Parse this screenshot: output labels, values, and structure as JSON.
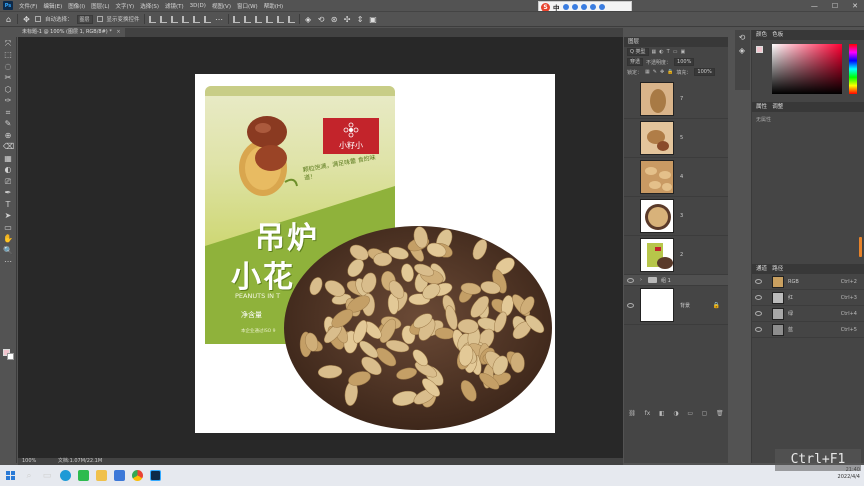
{
  "app": {
    "logo_text": "Ps"
  },
  "menu": [
    "文件(F)",
    "编辑(E)",
    "图像(I)",
    "图层(L)",
    "文字(Y)",
    "选择(S)",
    "滤镜(T)",
    "3D(D)",
    "视图(V)",
    "窗口(W)",
    "帮助(H)"
  ],
  "window_controls": {
    "minimize": "—",
    "maximize": "☐",
    "close": "✕"
  },
  "ime": {
    "label": "中"
  },
  "options_bar": {
    "auto_select_label": "自动选择：",
    "auto_select_value": "图层",
    "show_transform_label": "显示变换控件"
  },
  "document_tab": {
    "label": "未标题-1 @ 100% (图层 1, RGB/8#) *",
    "close": "×"
  },
  "tools": [
    "⤧",
    "⬚",
    "◌",
    "✂",
    "⬡",
    "✑",
    "⌗",
    "✎",
    "⊕",
    "⌫",
    "▦",
    "◐",
    "⎚",
    "✒",
    "T",
    "➤",
    "▭",
    "✋",
    "🔍",
    "⋯"
  ],
  "canvas_product": {
    "brand": "小籽小",
    "slogan": "颗粒饱满，满足味蕾 食的味道！",
    "title_line1": "吊炉",
    "title_line2": "小花",
    "en_text": "PEANUTS IN T",
    "net_weight": "净含量",
    "cert": "本企业通过ISO 9"
  },
  "layers_panel": {
    "title": "图层",
    "kind_select": "Q 类型",
    "blend_mode": "穿透",
    "opacity_label": "不透明度：",
    "opacity_value": "100%",
    "lock_label": "锁定：",
    "fill_label": "填充：",
    "fill_value": "100%",
    "layers": [
      {
        "name": "7",
        "visible": false
      },
      {
        "name": "5",
        "visible": false
      },
      {
        "name": "4",
        "visible": false
      },
      {
        "name": "3",
        "visible": false
      },
      {
        "name": "2",
        "visible": false
      }
    ],
    "group_name": "组 1",
    "background_name": "背景",
    "footer_icons": [
      "⛓",
      "fx",
      "◧",
      "◑",
      "▭",
      "▢",
      "🗑"
    ]
  },
  "color_panel": {
    "tab_color": "颜色",
    "tab_swatches": "色板"
  },
  "properties_panel": {
    "tab_properties": "属性",
    "tab_adjust": "调整",
    "empty_text": "无属性"
  },
  "channels_panel": {
    "tab_channels": "通道",
    "tab_paths": "路径",
    "channels": [
      {
        "name": "RGB",
        "shortcut": "Ctrl+2"
      },
      {
        "name": "红",
        "shortcut": "Ctrl+3"
      },
      {
        "name": "绿",
        "shortcut": "Ctrl+4"
      },
      {
        "name": "蓝",
        "shortcut": "Ctrl+5"
      }
    ]
  },
  "status_bar": {
    "zoom": "100%",
    "doc_info": "文档:1.07M/22.1M"
  },
  "taskbar": {
    "time": "21:40",
    "date": "2022/4/4"
  },
  "overlay": {
    "shortcut": "Ctrl+F1"
  },
  "colors": {
    "accent": "#31a8ff",
    "canvas_bg": "#282828",
    "ui_bg": "#535353",
    "panel_bg": "#454545",
    "foreground_swatch": "#f2c6cf"
  }
}
